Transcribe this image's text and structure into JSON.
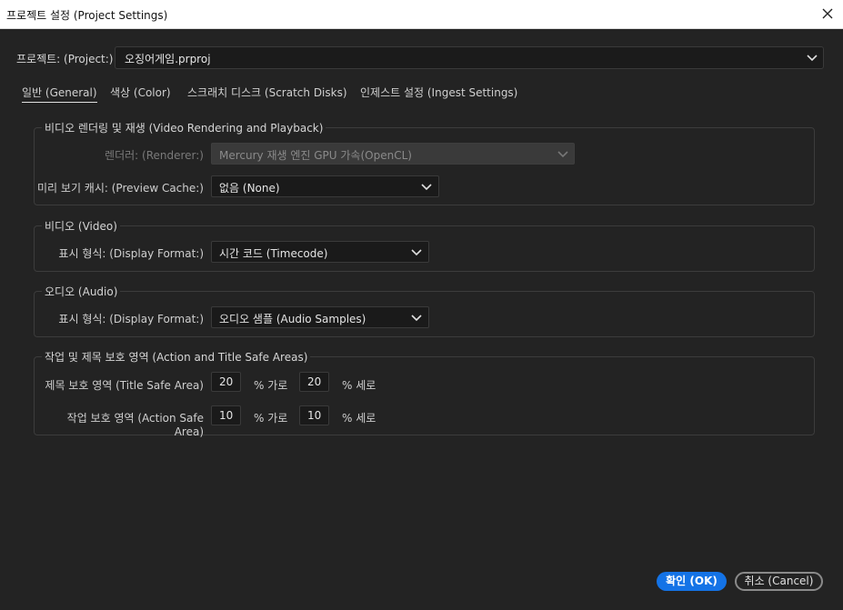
{
  "window": {
    "title": "프로젝트 설정 (Project Settings)",
    "close_icon": "close-icon"
  },
  "project": {
    "label": "프로젝트: (Project:)",
    "value": "오징어게임.prproj"
  },
  "tabs": [
    {
      "label": "일반 (General)",
      "active": true
    },
    {
      "label": "색상 (Color)",
      "active": false
    },
    {
      "label": "스크래치 디스크 (Scratch Disks)",
      "active": false
    },
    {
      "label": "인제스트 설정 (Ingest Settings)",
      "active": false
    }
  ],
  "video_rendering": {
    "legend": "비디오 렌더링 및 재생 (Video Rendering and Playback)",
    "renderer_label": "렌더러: (Renderer:)",
    "renderer_value": "Mercury 재생 엔진 GPU 가속(OpenCL)",
    "renderer_disabled": true,
    "preview_cache_label": "미리 보기 캐시: (Preview Cache:)",
    "preview_cache_value": "없음 (None)"
  },
  "video": {
    "legend": "비디오 (Video)",
    "display_format_label": "표시 형식: (Display Format:)",
    "display_format_value": "시간 코드 (Timecode)"
  },
  "audio": {
    "legend": "오디오 (Audio)",
    "display_format_label": "표시 형식: (Display Format:)",
    "display_format_value": "오디오 샘플 (Audio Samples)"
  },
  "safe_areas": {
    "legend": "작업 및 제목 보호 영역 (Action and Title Safe Areas)",
    "title_safe_label": "제목 보호 영역 (Title Safe Area)",
    "title_safe_h": "20",
    "title_safe_v": "20",
    "action_safe_label": "작업 보호 영역 (Action Safe Area)",
    "action_safe_h": "10",
    "action_safe_v": "10",
    "unit_horizontal": "% 가로",
    "unit_vertical": "% 세로"
  },
  "buttons": {
    "ok": "확인 (OK)",
    "cancel": "취소 (Cancel)"
  },
  "colors": {
    "background": "#232323",
    "accent": "#1473e6",
    "titlebar": "#ffffff"
  }
}
